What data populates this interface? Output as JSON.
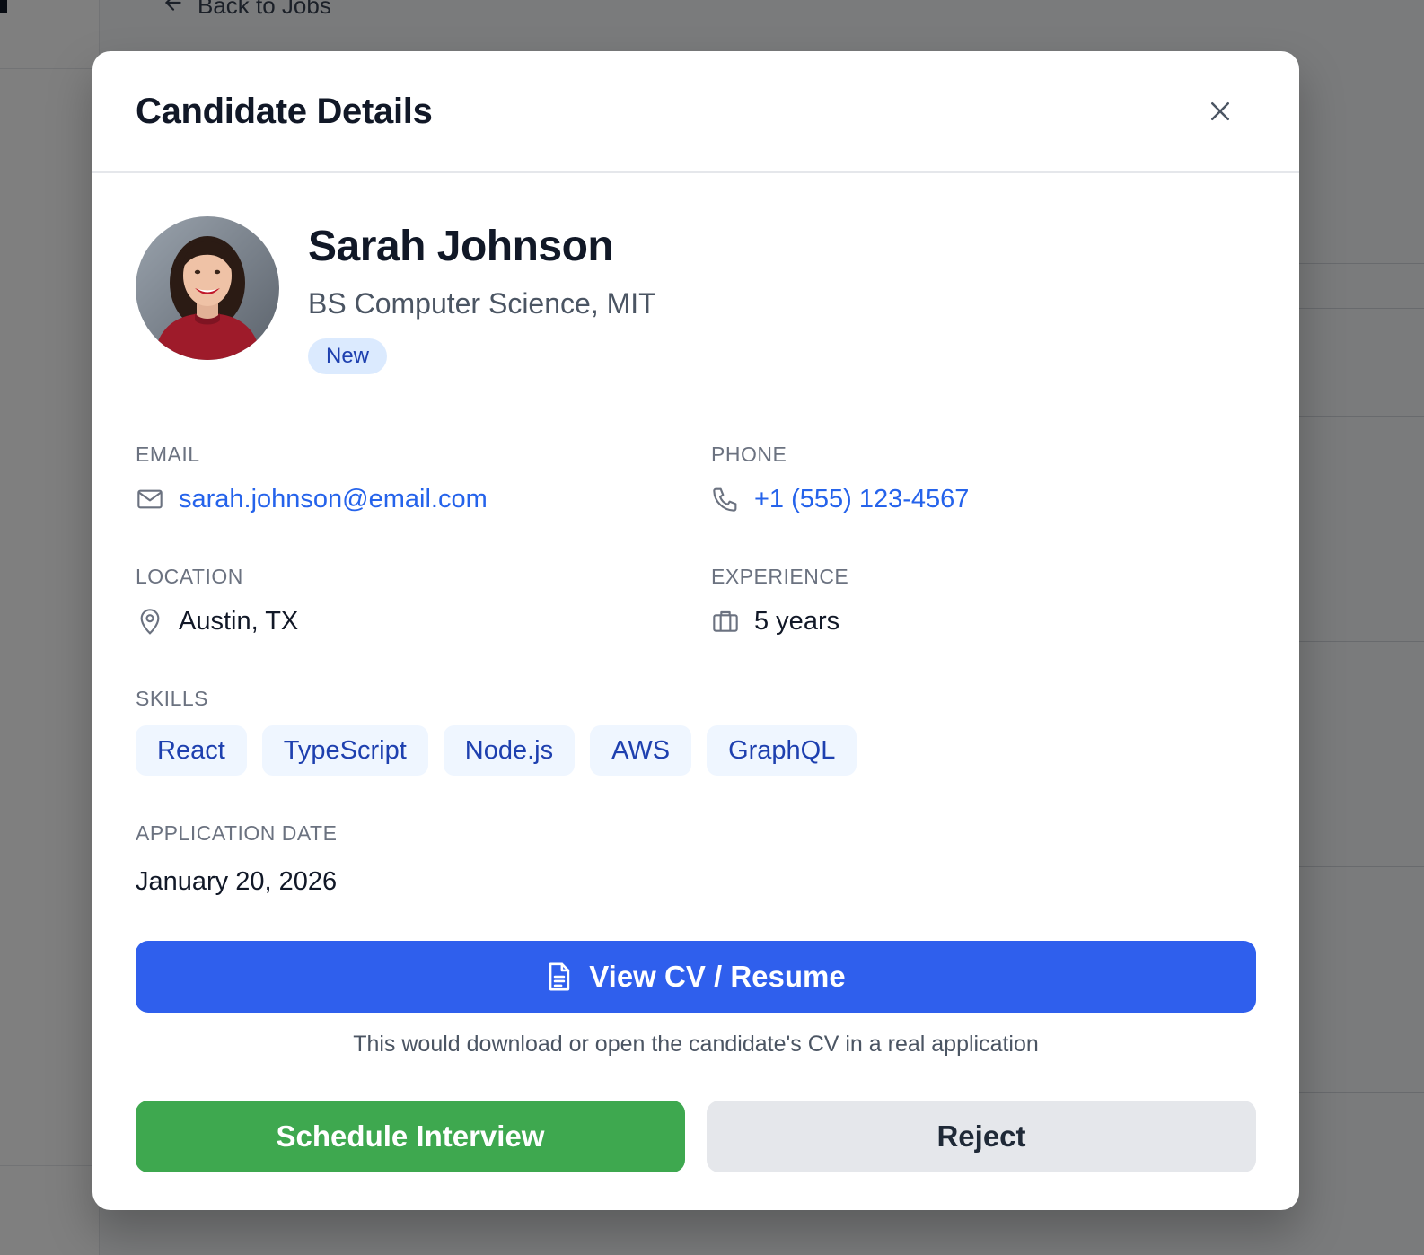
{
  "background": {
    "back_link": "Back to Jobs"
  },
  "modal": {
    "title": "Candidate Details",
    "close_icon": "close-icon"
  },
  "candidate": {
    "name": "Sarah Johnson",
    "education": "BS Computer Science, MIT",
    "status": "New",
    "avatar": "candidate-photo"
  },
  "fields": {
    "email": {
      "label": "EMAIL",
      "value": "sarah.johnson@email.com",
      "icon": "mail-icon"
    },
    "phone": {
      "label": "PHONE",
      "value": "+1 (555) 123-4567",
      "icon": "phone-icon"
    },
    "location": {
      "label": "LOCATION",
      "value": "Austin, TX",
      "icon": "map-pin-icon"
    },
    "experience": {
      "label": "EXPERIENCE",
      "value": "5 years",
      "icon": "briefcase-icon"
    }
  },
  "skills": {
    "label": "SKILLS",
    "items": [
      "React",
      "TypeScript",
      "Node.js",
      "AWS",
      "GraphQL"
    ]
  },
  "application_date": {
    "label": "APPLICATION DATE",
    "value": "January 20, 2026"
  },
  "cv": {
    "button_label": "View CV / Resume",
    "icon": "document-icon",
    "note": "This would download or open the candidate's CV in a real application"
  },
  "actions": {
    "schedule_label": "Schedule Interview",
    "reject_label": "Reject"
  },
  "colors": {
    "primary": "#2f5fed",
    "success": "#3ea84f",
    "link": "#2563eb",
    "badge_bg": "#dbeafe",
    "badge_text": "#1e40af",
    "neutral_button": "#e5e7eb"
  }
}
